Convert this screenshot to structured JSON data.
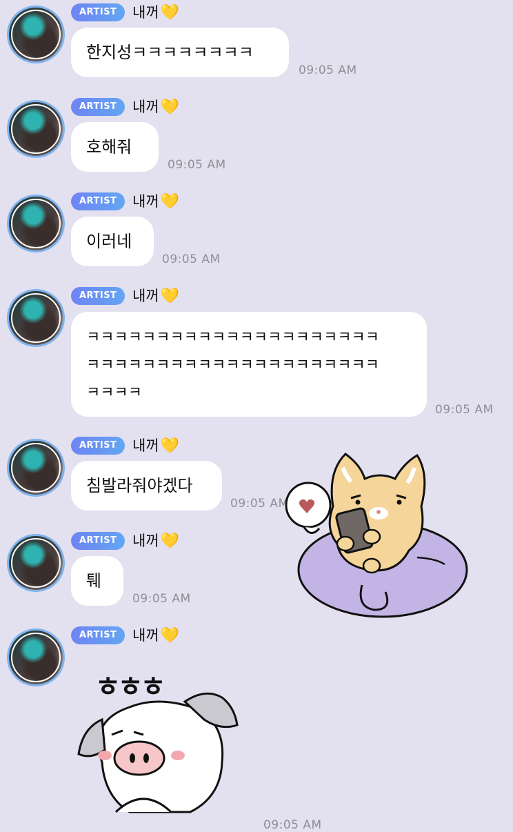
{
  "artist_badge": "ARTIST",
  "sender_name": "내꺼",
  "heart_glyph": "💛",
  "messages": [
    {
      "text": "한지성ㅋㅋㅋㅋㅋㅋㅋㅋ",
      "time": "09:05 AM"
    },
    {
      "text": "호해줘",
      "time": "09:05 AM"
    },
    {
      "text": "이러네",
      "time": "09:05 AM"
    },
    {
      "lines": [
        "ㅋㅋㅋㅋㅋㅋㅋㅋㅋㅋㅋㅋㅋㅋㅋㅋㅋㅋㅋㅋㅋ",
        "ㅋㅋㅋㅋㅋㅋㅋㅋㅋㅋㅋㅋㅋㅋㅋㅋㅋㅋㅋㅋㅋ",
        "ㅋㅋㅋㅋ"
      ],
      "time": "09:05 AM"
    },
    {
      "text": "침발라줘야겠다",
      "time": "09:05 AM"
    },
    {
      "text": "퉤",
      "time": "09:05 AM"
    },
    {
      "sticker_text": "ㅎㅎㅎ",
      "time": "09:05 AM"
    }
  ],
  "stickers": {
    "cat": "cat-on-beanbag-with-phone-and-heart",
    "pig": "white-pig-laughing"
  },
  "colors": {
    "background": "#e3e0ef",
    "bubble": "#ffffff",
    "badge_start": "#6e84f3",
    "badge_end": "#63a6f2",
    "timestamp": "#8f8f96"
  }
}
